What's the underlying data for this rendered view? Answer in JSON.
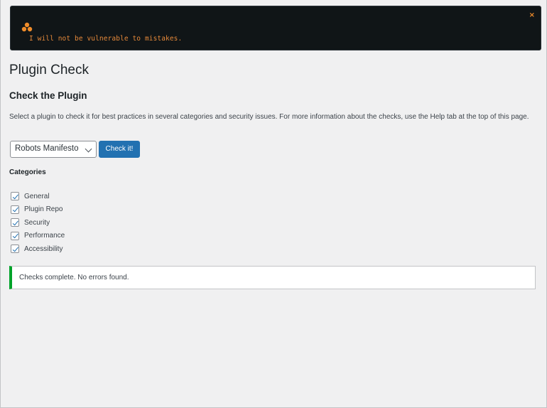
{
  "notice": {
    "message": "I will not be vulnerable to mistakes.",
    "logo_icon": "orange-tri-dots-logo-icon",
    "dismiss_icon": "close-icon",
    "dismiss_glyph": "×",
    "accent": "#e6893a"
  },
  "page": {
    "title": "Plugin Check"
  },
  "section": {
    "title": "Check the Plugin",
    "description": "Select a plugin to check it for best practices in several categories and security issues. For more information about the checks, use the Help tab at the top of this page."
  },
  "form": {
    "selected_plugin": "Robots Manifesto",
    "submit_label": "Check it!",
    "submit_color": "#2271b1"
  },
  "categories": {
    "label": "Categories",
    "items": [
      {
        "label": "General",
        "checked": true
      },
      {
        "label": "Plugin Repo",
        "checked": true
      },
      {
        "label": "Security",
        "checked": true
      },
      {
        "label": "Performance",
        "checked": true
      },
      {
        "label": "Accessibility",
        "checked": true
      }
    ]
  },
  "result": {
    "message": "Checks complete. No errors found.",
    "status_color": "#00a32a"
  }
}
